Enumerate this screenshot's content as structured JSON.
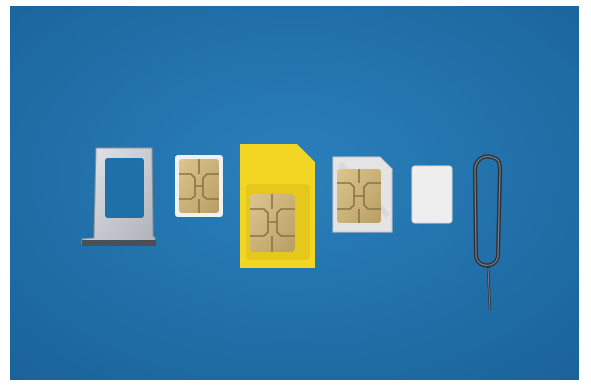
{
  "photo": {
    "colors": {
      "background": "#1f6fa8",
      "background_light": "#2a80bb",
      "tray_silver": "#c9ccd1",
      "tray_dark": "#4a4e57",
      "sim_yellow": "#f3d623",
      "chip_gold": "#cdb67e",
      "chip_line": "#8a7444",
      "white_card": "#eeeeee",
      "pin_metal": "#2d2f33"
    },
    "objects": [
      {
        "name": "sim-tray-icon"
      },
      {
        "name": "nano-sim-chip-icon"
      },
      {
        "name": "standard-sim-card-icon"
      },
      {
        "name": "micro-sim-card-icon"
      },
      {
        "name": "blank-sim-card-icon"
      },
      {
        "name": "eject-pin-icon"
      }
    ]
  }
}
